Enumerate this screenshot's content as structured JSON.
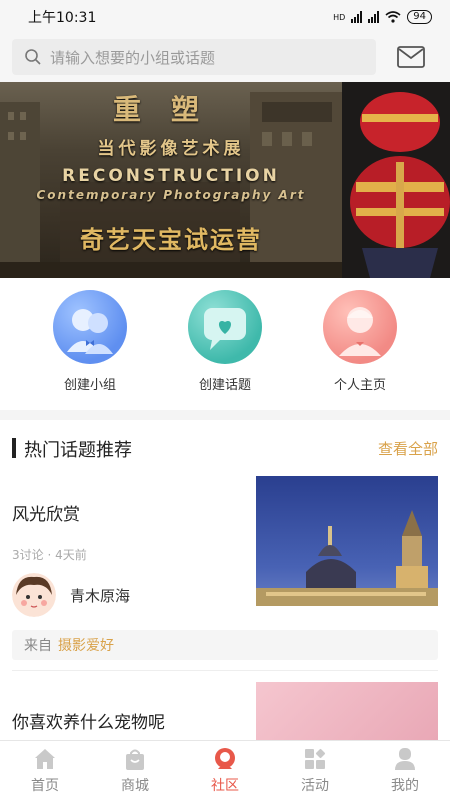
{
  "status_bar": {
    "time": "上午10:31",
    "network": "HD",
    "battery": "94"
  },
  "search": {
    "placeholder": "请输入想要的小组或话题",
    "icon": "search-icon",
    "mail_icon": "mail-icon"
  },
  "banner": {
    "title": "重塑",
    "subtitle": "当代影像艺术展",
    "english_title": "RECONSTRUCTION",
    "english_subtitle": "Contemporary Photography Art",
    "promo_text": "奇艺天宝试运营"
  },
  "quick_actions": [
    {
      "label": "创建小组",
      "icon": "create-group-icon",
      "color": "#6a97f2"
    },
    {
      "label": "创建话题",
      "icon": "create-topic-icon",
      "color": "#45bcae"
    },
    {
      "label": "个人主页",
      "icon": "profile-icon",
      "color": "#f28e88"
    }
  ],
  "hot_topics": {
    "title": "热门话题推荐",
    "more_label": "查看全部",
    "items": [
      {
        "name": "风光欣赏",
        "meta": "3讨论 · 4天前",
        "user": "青木原海",
        "from_label": "来自",
        "group": "摄影爱好"
      },
      {
        "name": "你喜欢养什么宠物呢"
      }
    ]
  },
  "bottom_nav": [
    {
      "label": "首页",
      "icon": "home-icon",
      "active": false
    },
    {
      "label": "商城",
      "icon": "shop-icon",
      "active": false
    },
    {
      "label": "社区",
      "icon": "community-icon",
      "active": true
    },
    {
      "label": "活动",
      "icon": "activity-icon",
      "active": false
    },
    {
      "label": "我的",
      "icon": "user-icon",
      "active": false
    }
  ],
  "colors": {
    "accent": "#d9a24a",
    "active_tab": "#e8584a"
  }
}
